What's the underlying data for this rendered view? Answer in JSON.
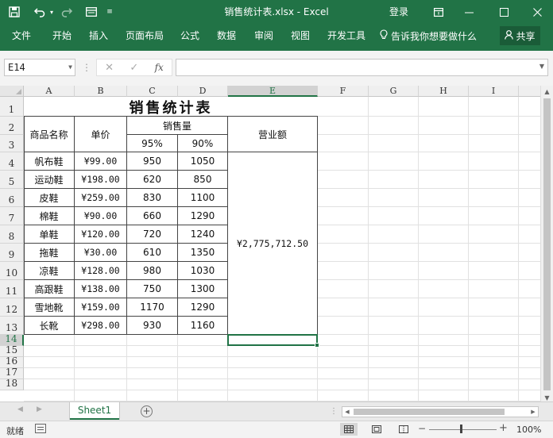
{
  "window": {
    "title": "销售统计表.xlsx  -  Excel",
    "login": "登录",
    "icons": [
      "save-icon",
      "undo-icon",
      "redo-icon",
      "form-icon",
      "customize-icon",
      "ribbon-display-icon",
      "minimize-icon",
      "maximize-icon",
      "close-icon"
    ]
  },
  "ribbon": {
    "tabs": [
      "文件",
      "开始",
      "插入",
      "页面布局",
      "公式",
      "数据",
      "审阅",
      "视图",
      "开发工具"
    ],
    "tell_me": "告诉我你想要做什么",
    "share": "共享"
  },
  "formula_bar": {
    "name_box": "E14",
    "fx": "fx",
    "formula": ""
  },
  "grid": {
    "columns": [
      "A",
      "B",
      "C",
      "D",
      "E",
      "F",
      "G",
      "H",
      "I"
    ],
    "rows": [
      "1",
      "2",
      "3",
      "4",
      "5",
      "6",
      "7",
      "8",
      "9",
      "10",
      "11",
      "12",
      "13",
      "14",
      "15",
      "16",
      "17",
      "18"
    ],
    "active_column": "E",
    "active_row": "14"
  },
  "table": {
    "title": "销售统计表",
    "headers": {
      "product": "商品名称",
      "price": "单价",
      "sales": "销售量",
      "sales_sub": [
        "95%",
        "90%"
      ],
      "revenue": "营业额"
    },
    "rows": [
      {
        "name": "帆布鞋",
        "price": "¥99.00",
        "q95": "950",
        "q90": "1050"
      },
      {
        "name": "运动鞋",
        "price": "¥198.00",
        "q95": "620",
        "q90": "850"
      },
      {
        "name": "皮鞋",
        "price": "¥259.00",
        "q95": "830",
        "q90": "1100"
      },
      {
        "name": "棉鞋",
        "price": "¥90.00",
        "q95": "660",
        "q90": "1290"
      },
      {
        "name": "单鞋",
        "price": "¥120.00",
        "q95": "720",
        "q90": "1240"
      },
      {
        "name": "拖鞋",
        "price": "¥30.00",
        "q95": "610",
        "q90": "1350"
      },
      {
        "name": "凉鞋",
        "price": "¥128.00",
        "q95": "980",
        "q90": "1030"
      },
      {
        "name": "高跟鞋",
        "price": "¥138.00",
        "q95": "750",
        "q90": "1300"
      },
      {
        "name": "雪地靴",
        "price": "¥159.00",
        "q95": "1170",
        "q90": "1290"
      },
      {
        "name": "长靴",
        "price": "¥298.00",
        "q95": "930",
        "q90": "1160"
      }
    ],
    "revenue_value": "¥2,775,712.50"
  },
  "sheets": {
    "tabs": [
      "Sheet1"
    ],
    "active": "Sheet1"
  },
  "status": {
    "ready": "就绪",
    "zoom": "100%"
  },
  "colors": {
    "accent": "#217346",
    "share_bg": "#1a5c38"
  }
}
